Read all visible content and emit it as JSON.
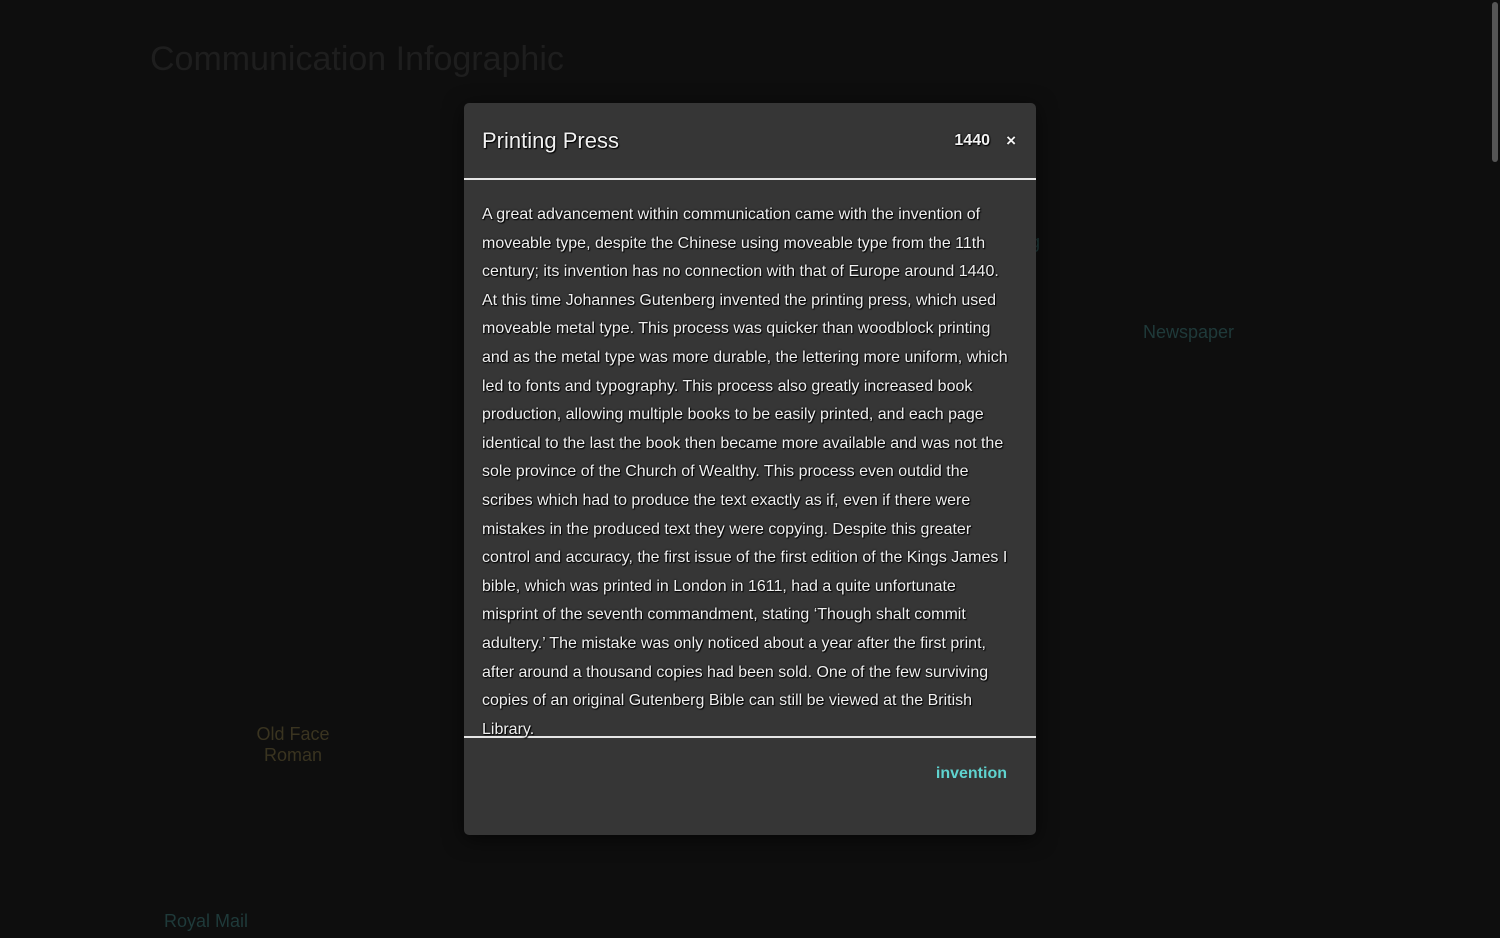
{
  "background": {
    "title": "Communication Infographic",
    "partial_label": "g",
    "labels": [
      {
        "text": "Newspaper",
        "color": "teal"
      },
      {
        "text": "Old Face\nRoman",
        "color": "olive"
      },
      {
        "text": "Royal Mail",
        "color": "teal"
      }
    ]
  },
  "modal": {
    "title": "Printing Press",
    "year": "1440",
    "close_label": "×",
    "body": "A great advancement within communication came with the invention of moveable type, despite the Chinese using moveable type from the 11th century; its invention has no connection with that of Europe around 1440. At this time Johannes Gutenberg invented the printing press, which used moveable metal type. This process was quicker than woodblock printing and as the metal type was more durable, the lettering more uniform, which led to fonts and typography. This process also greatly increased book production, allowing multiple books to be easily printed, and each page identical to the last the book then became more available and was not the sole province of the Church of Wealthy. This process even outdid the scribes which had to produce the text exactly as if, even if there were mistakes in the produced text they were copying. Despite this greater control and accuracy, the first issue of the first edition of the Kings James I bible, which was printed in London in 1611, had a quite unfortunate misprint of the seventh commandment, stating ‘Though shalt commit adultery.’ The mistake was only noticed about a year after the first print, after around a thousand copies had been sold. One of the few surviving copies of an original Gutenberg Bible can still be viewed at the British Library.",
    "tag": "invention"
  },
  "colors": {
    "background": "#0e0e0e",
    "modal_bg": "#363636",
    "accent": "#5fd3cf"
  }
}
